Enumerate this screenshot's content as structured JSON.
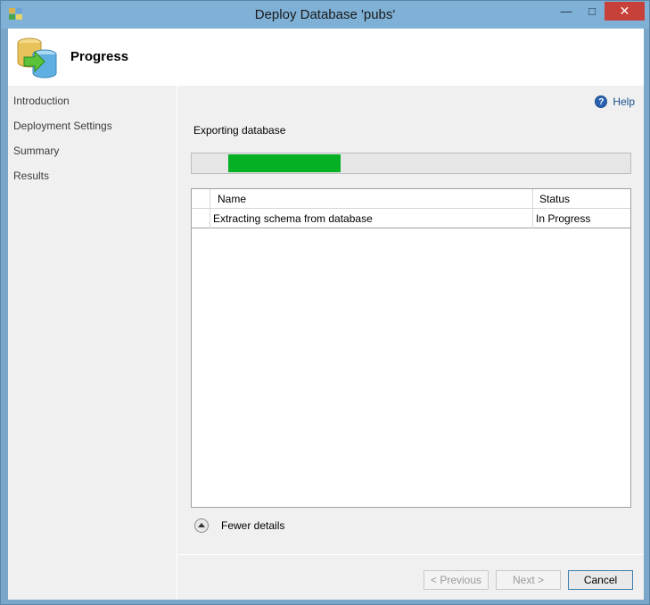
{
  "window": {
    "title": "Deploy Database 'pubs'",
    "minimize_glyph": "—",
    "maximize_glyph": "□",
    "close_glyph": "✕"
  },
  "header": {
    "title": "Progress",
    "icon": "database-deploy-icon"
  },
  "nav": {
    "items": [
      {
        "label": "Introduction"
      },
      {
        "label": "Deployment Settings"
      },
      {
        "label": "Summary"
      },
      {
        "label": "Results"
      }
    ]
  },
  "main": {
    "help_label": "Help",
    "help_glyph": "?",
    "status_text": "Exporting database",
    "progress": {
      "fill_start_fraction": 0.083,
      "fill_end_fraction": 0.34,
      "color": "#06b025"
    },
    "table": {
      "columns": [
        "Name",
        "Status"
      ],
      "rows": [
        {
          "name": "Extracting schema from database",
          "status": "In Progress"
        }
      ]
    },
    "fewer_details_label": "Fewer details"
  },
  "buttons": {
    "previous": "< Previous",
    "next": "Next >",
    "cancel": "Cancel"
  },
  "colors": {
    "titlebar": "#7fb0d6",
    "close_button": "#c7413a",
    "help_link": "#1a4f8b",
    "progress_fill": "#06b025"
  }
}
